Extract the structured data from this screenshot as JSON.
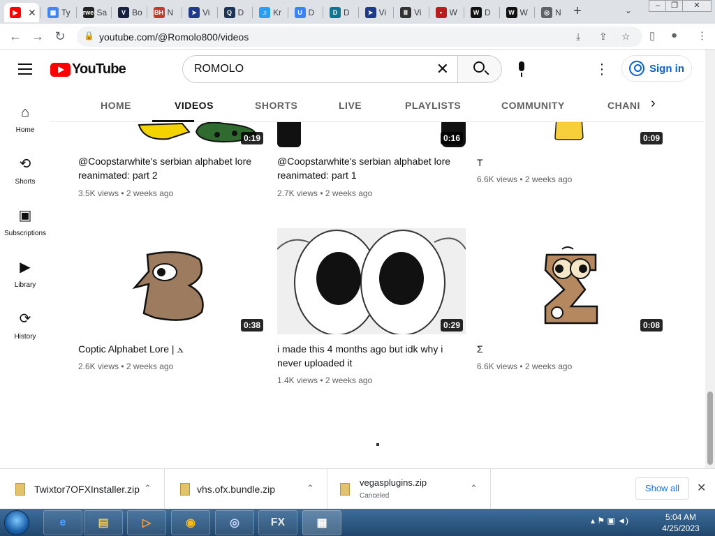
{
  "browser": {
    "tabs": [
      {
        "label": "",
        "favicon": "youtube-icon",
        "color": "#ff0000",
        "glyph": "▶",
        "active": true
      },
      {
        "label": "Ty",
        "favicon": "doc-icon",
        "color": "#4285f4",
        "glyph": "▦"
      },
      {
        "label": "Sa",
        "favicon": "rwe-icon",
        "color": "#222222",
        "glyph": "rwe"
      },
      {
        "label": "Bo",
        "favicon": "v-icon",
        "color": "#16213e",
        "glyph": "V"
      },
      {
        "label": "N",
        "favicon": "bh-icon",
        "color": "#c0392b",
        "glyph": "BH"
      },
      {
        "label": "Vi",
        "favicon": "arrow-icon",
        "color": "#1f3a8a",
        "glyph": "➤"
      },
      {
        "label": "D",
        "favicon": "q-icon",
        "color": "#1d3557",
        "glyph": "Q"
      },
      {
        "label": "Kr",
        "favicon": "music-icon",
        "color": "#2a9df4",
        "glyph": "♫"
      },
      {
        "label": "D",
        "favicon": "u-icon",
        "color": "#3b82f6",
        "glyph": "U"
      },
      {
        "label": "D",
        "favicon": "d-icon",
        "color": "#0e7490",
        "glyph": "D"
      },
      {
        "label": "Vi",
        "favicon": "arrow-icon",
        "color": "#1f3a8a",
        "glyph": "➤"
      },
      {
        "label": "Vi",
        "favicon": "museum-icon",
        "color": "#333333",
        "glyph": "Ⅲ"
      },
      {
        "label": "W",
        "favicon": "wiki-icon",
        "color": "#b91c1c",
        "glyph": "•"
      },
      {
        "label": "D",
        "favicon": "w-icon",
        "color": "#111111",
        "glyph": "W"
      },
      {
        "label": "W",
        "favicon": "w-icon",
        "color": "#111111",
        "glyph": "W"
      },
      {
        "label": "N",
        "favicon": "globe-icon",
        "color": "#5f6368",
        "glyph": "◎"
      }
    ],
    "url": "youtube.com/@Romolo800/videos"
  },
  "youtube": {
    "logo_text": "YouTube",
    "search_query": "ROMOLO",
    "sign_in_label": "Sign in",
    "nav": [
      {
        "label": "Home",
        "icon": "home-icon",
        "glyph": "⌂"
      },
      {
        "label": "Shorts",
        "icon": "shorts-icon",
        "glyph": "⟲"
      },
      {
        "label": "Subscriptions",
        "icon": "subscriptions-icon",
        "glyph": "▣"
      },
      {
        "label": "Library",
        "icon": "library-icon",
        "glyph": "▶"
      },
      {
        "label": "History",
        "icon": "history-icon",
        "glyph": "⟳"
      }
    ],
    "channel_tabs": [
      "HOME",
      "VIDEOS",
      "SHORTS",
      "LIVE",
      "PLAYLISTS",
      "COMMUNITY",
      "CHANI"
    ],
    "selected_tab": "VIDEOS",
    "videos": [
      {
        "title": "@Coopstarwhite's serbian alphabet lore reanimated: part 2",
        "meta": "3.5K views • 2 weeks ago",
        "duration": "0:19"
      },
      {
        "title": "@Coopstarwhite's serbian alphabet lore reanimated: part 1",
        "meta": "2.7K views • 2 weeks ago",
        "duration": "0:16"
      },
      {
        "title": "T",
        "meta": "6.6K views • 2 weeks ago",
        "duration": "0:09"
      },
      {
        "title": "Coptic Alphabet Lore | ⲇ",
        "meta": "2.6K views • 2 weeks ago",
        "duration": "0:38"
      },
      {
        "title": "i made this 4 months ago but idk why i never uploaded it",
        "meta": "1.4K views • 2 weeks ago",
        "duration": "0:29"
      },
      {
        "title": "Σ",
        "meta": "6.6K views • 2 weeks ago",
        "duration": "0:08"
      }
    ]
  },
  "downloads": {
    "items": [
      {
        "name": "Twixtor7OFXInstaller.zip",
        "status": ""
      },
      {
        "name": "vhs.ofx.bundle.zip",
        "status": ""
      },
      {
        "name": "vegasplugins.zip",
        "status": "Canceled"
      }
    ],
    "show_all_label": "Show all"
  },
  "taskbar": {
    "apps": [
      "ie-icon",
      "explorer-icon",
      "media-icon",
      "chrome-icon",
      "magnifier-icon",
      "fx-icon",
      "film-icon"
    ],
    "time": "5:04 AM",
    "date": "4/25/2023"
  }
}
